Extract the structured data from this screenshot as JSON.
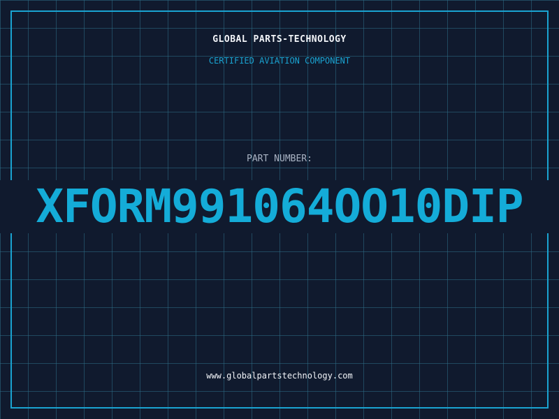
{
  "header": {
    "company": "GLOBAL PARTS-TECHNOLOGY",
    "subtitle": "CERTIFIED AVIATION COMPONENT"
  },
  "part": {
    "label": "PART NUMBER:",
    "number": "XFORM991064OO10DIP"
  },
  "footer": {
    "website": "www.globalpartstechnology.com"
  },
  "colors": {
    "background": "#101a2e",
    "grid": "#2e6e87",
    "accent": "#1aa3d1",
    "text": "#f2f4f8",
    "muted": "#aab4c4"
  }
}
